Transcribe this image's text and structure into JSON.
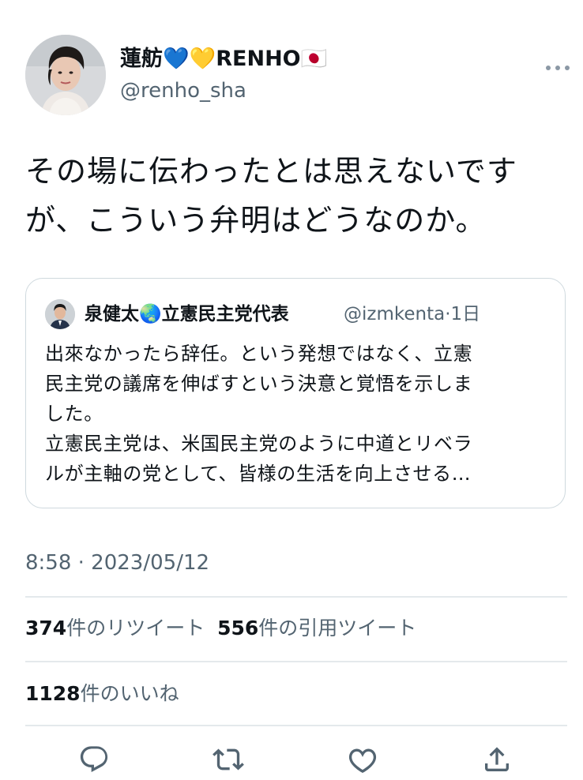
{
  "author": {
    "display_name": "蓮舫💙💛RENHO🇯🇵",
    "handle": "@renho_sha"
  },
  "tweet": {
    "line1": "その場に伝わったとは思えないです",
    "line2": "が、こういう弁明はどうなのか。"
  },
  "quote": {
    "display_name": "泉健太🌏立憲民主党代表",
    "handle": "@izmkenta",
    "separator": "·",
    "age": "1日",
    "lines": [
      "出來なかったら辞任。という発想ではなく、立憲",
      "民主党の議席を伸ばすという決意と覚悟を示しま",
      "した。",
      "立憲民主党は、米国民主党のように中道とリベラ",
      "ルが主軸の党として、皆様の生活を向上させる…"
    ]
  },
  "timestamp": "8:58 · 2023/05/12",
  "stats": {
    "retweets_count": "374",
    "retweets_label": "件のリツイート",
    "quotes_count": "556",
    "quotes_label": "件の引用ツイート",
    "likes_count": "1128",
    "likes_label": "件のいいね"
  },
  "icons": {
    "more": "more-horizontal-icon",
    "reply": "reply-icon",
    "retweet": "retweet-icon",
    "like": "heart-icon",
    "share": "share-icon"
  },
  "colors": {
    "text": "#0f1419",
    "secondary": "#536471",
    "border": "#cfd9de",
    "divider": "#e4e9ec"
  }
}
